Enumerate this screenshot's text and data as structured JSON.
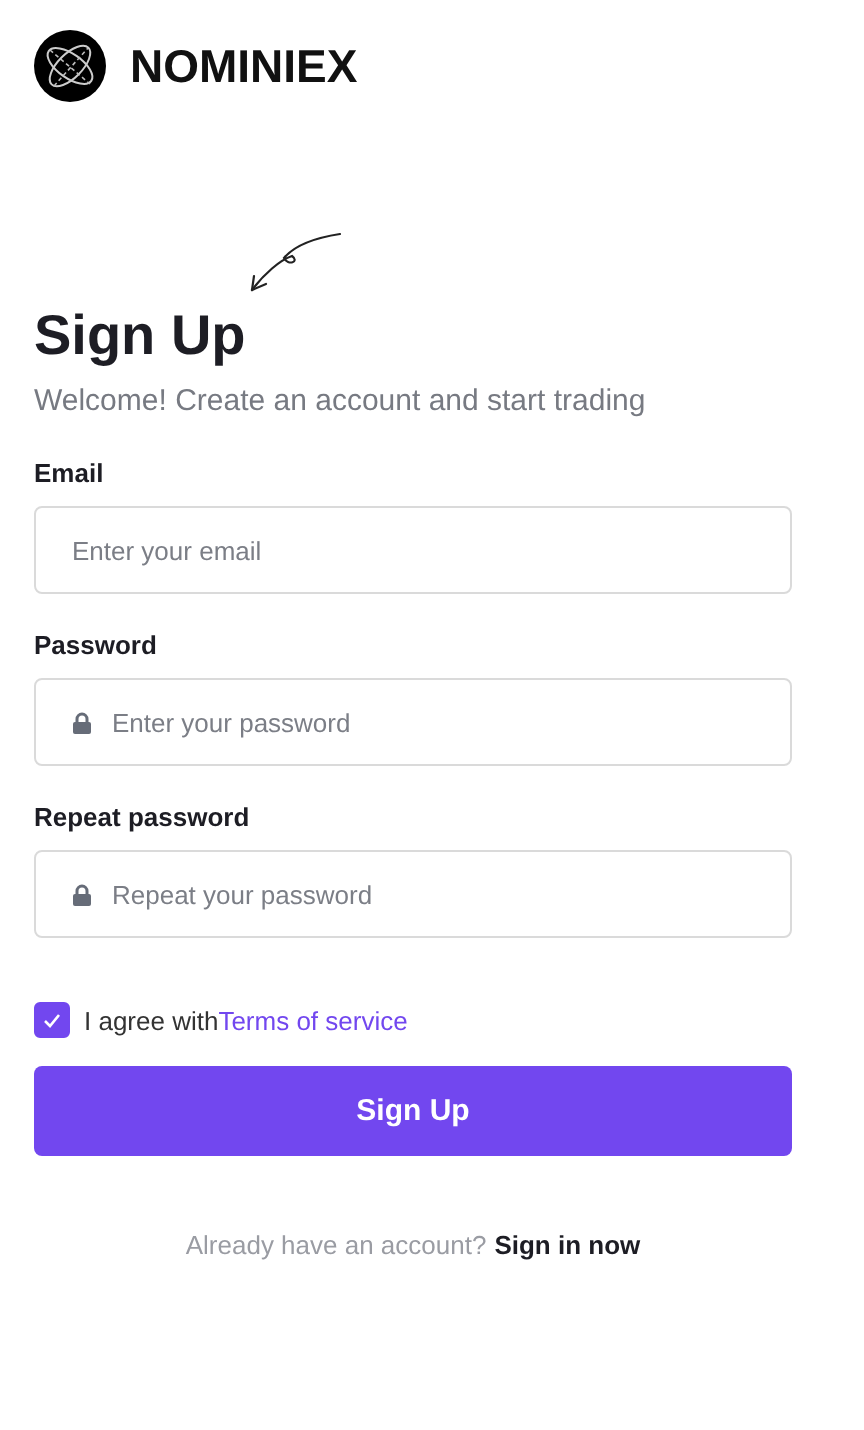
{
  "brand": {
    "name": "NOMINIEX"
  },
  "heading": "Sign Up",
  "subtitle": "Welcome! Create an account and start trading",
  "fields": [
    {
      "label": "Email",
      "placeholder": "Enter your email",
      "kind": "text"
    },
    {
      "label": "Password",
      "placeholder": "Enter your password",
      "kind": "password"
    },
    {
      "label": "Repeat password",
      "placeholder": "Repeat your password",
      "kind": "password"
    }
  ],
  "agree": {
    "text": "I agree with",
    "link": "Terms of service",
    "checked": true
  },
  "submit": "Sign Up",
  "footer": {
    "text": "Already have an account?",
    "link": "Sign in now"
  }
}
